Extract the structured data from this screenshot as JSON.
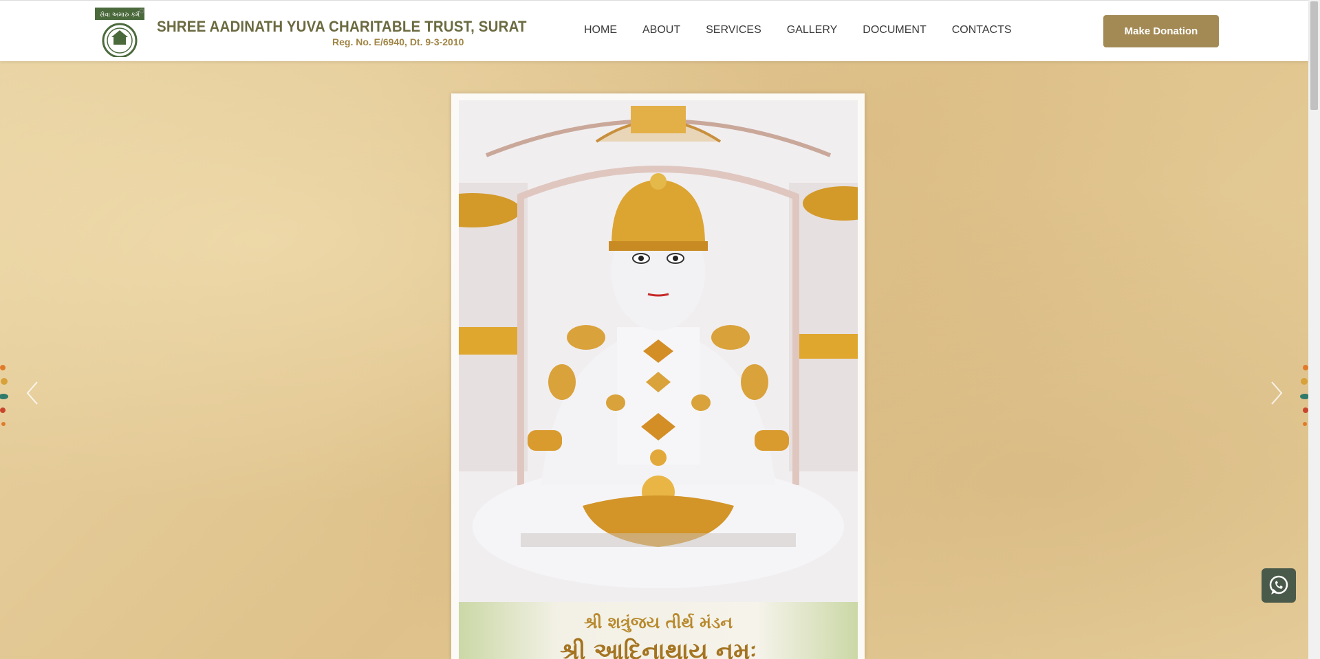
{
  "header": {
    "logo_badge_text": "સેવા અમારુ કર્મ",
    "logo_title": "SHREE AADINATH YUVA CHARITABLE TRUST, SURAT",
    "logo_reg": "Reg. No. E/6940, Dt. 9-3-2010",
    "nav": [
      {
        "label": "HOME"
      },
      {
        "label": "ABOUT"
      },
      {
        "label": "SERVICES"
      },
      {
        "label": "GALLERY"
      },
      {
        "label": "DOCUMENT"
      },
      {
        "label": "CONTACTS"
      }
    ],
    "donate_label": "Make Donation"
  },
  "hero": {
    "caption_line1": "શ્રી શત્રુંજય તીર્થ મંડન",
    "caption_line2": "શ્રી આદિનાથાય નમઃ"
  },
  "icons": {
    "prev": "chevron-left-icon",
    "next": "chevron-right-icon",
    "whatsapp": "whatsapp-icon"
  },
  "colors": {
    "accent": "#a38a55",
    "logo_green": "#6b6a40",
    "hero_bg": "#e6cf9d"
  }
}
